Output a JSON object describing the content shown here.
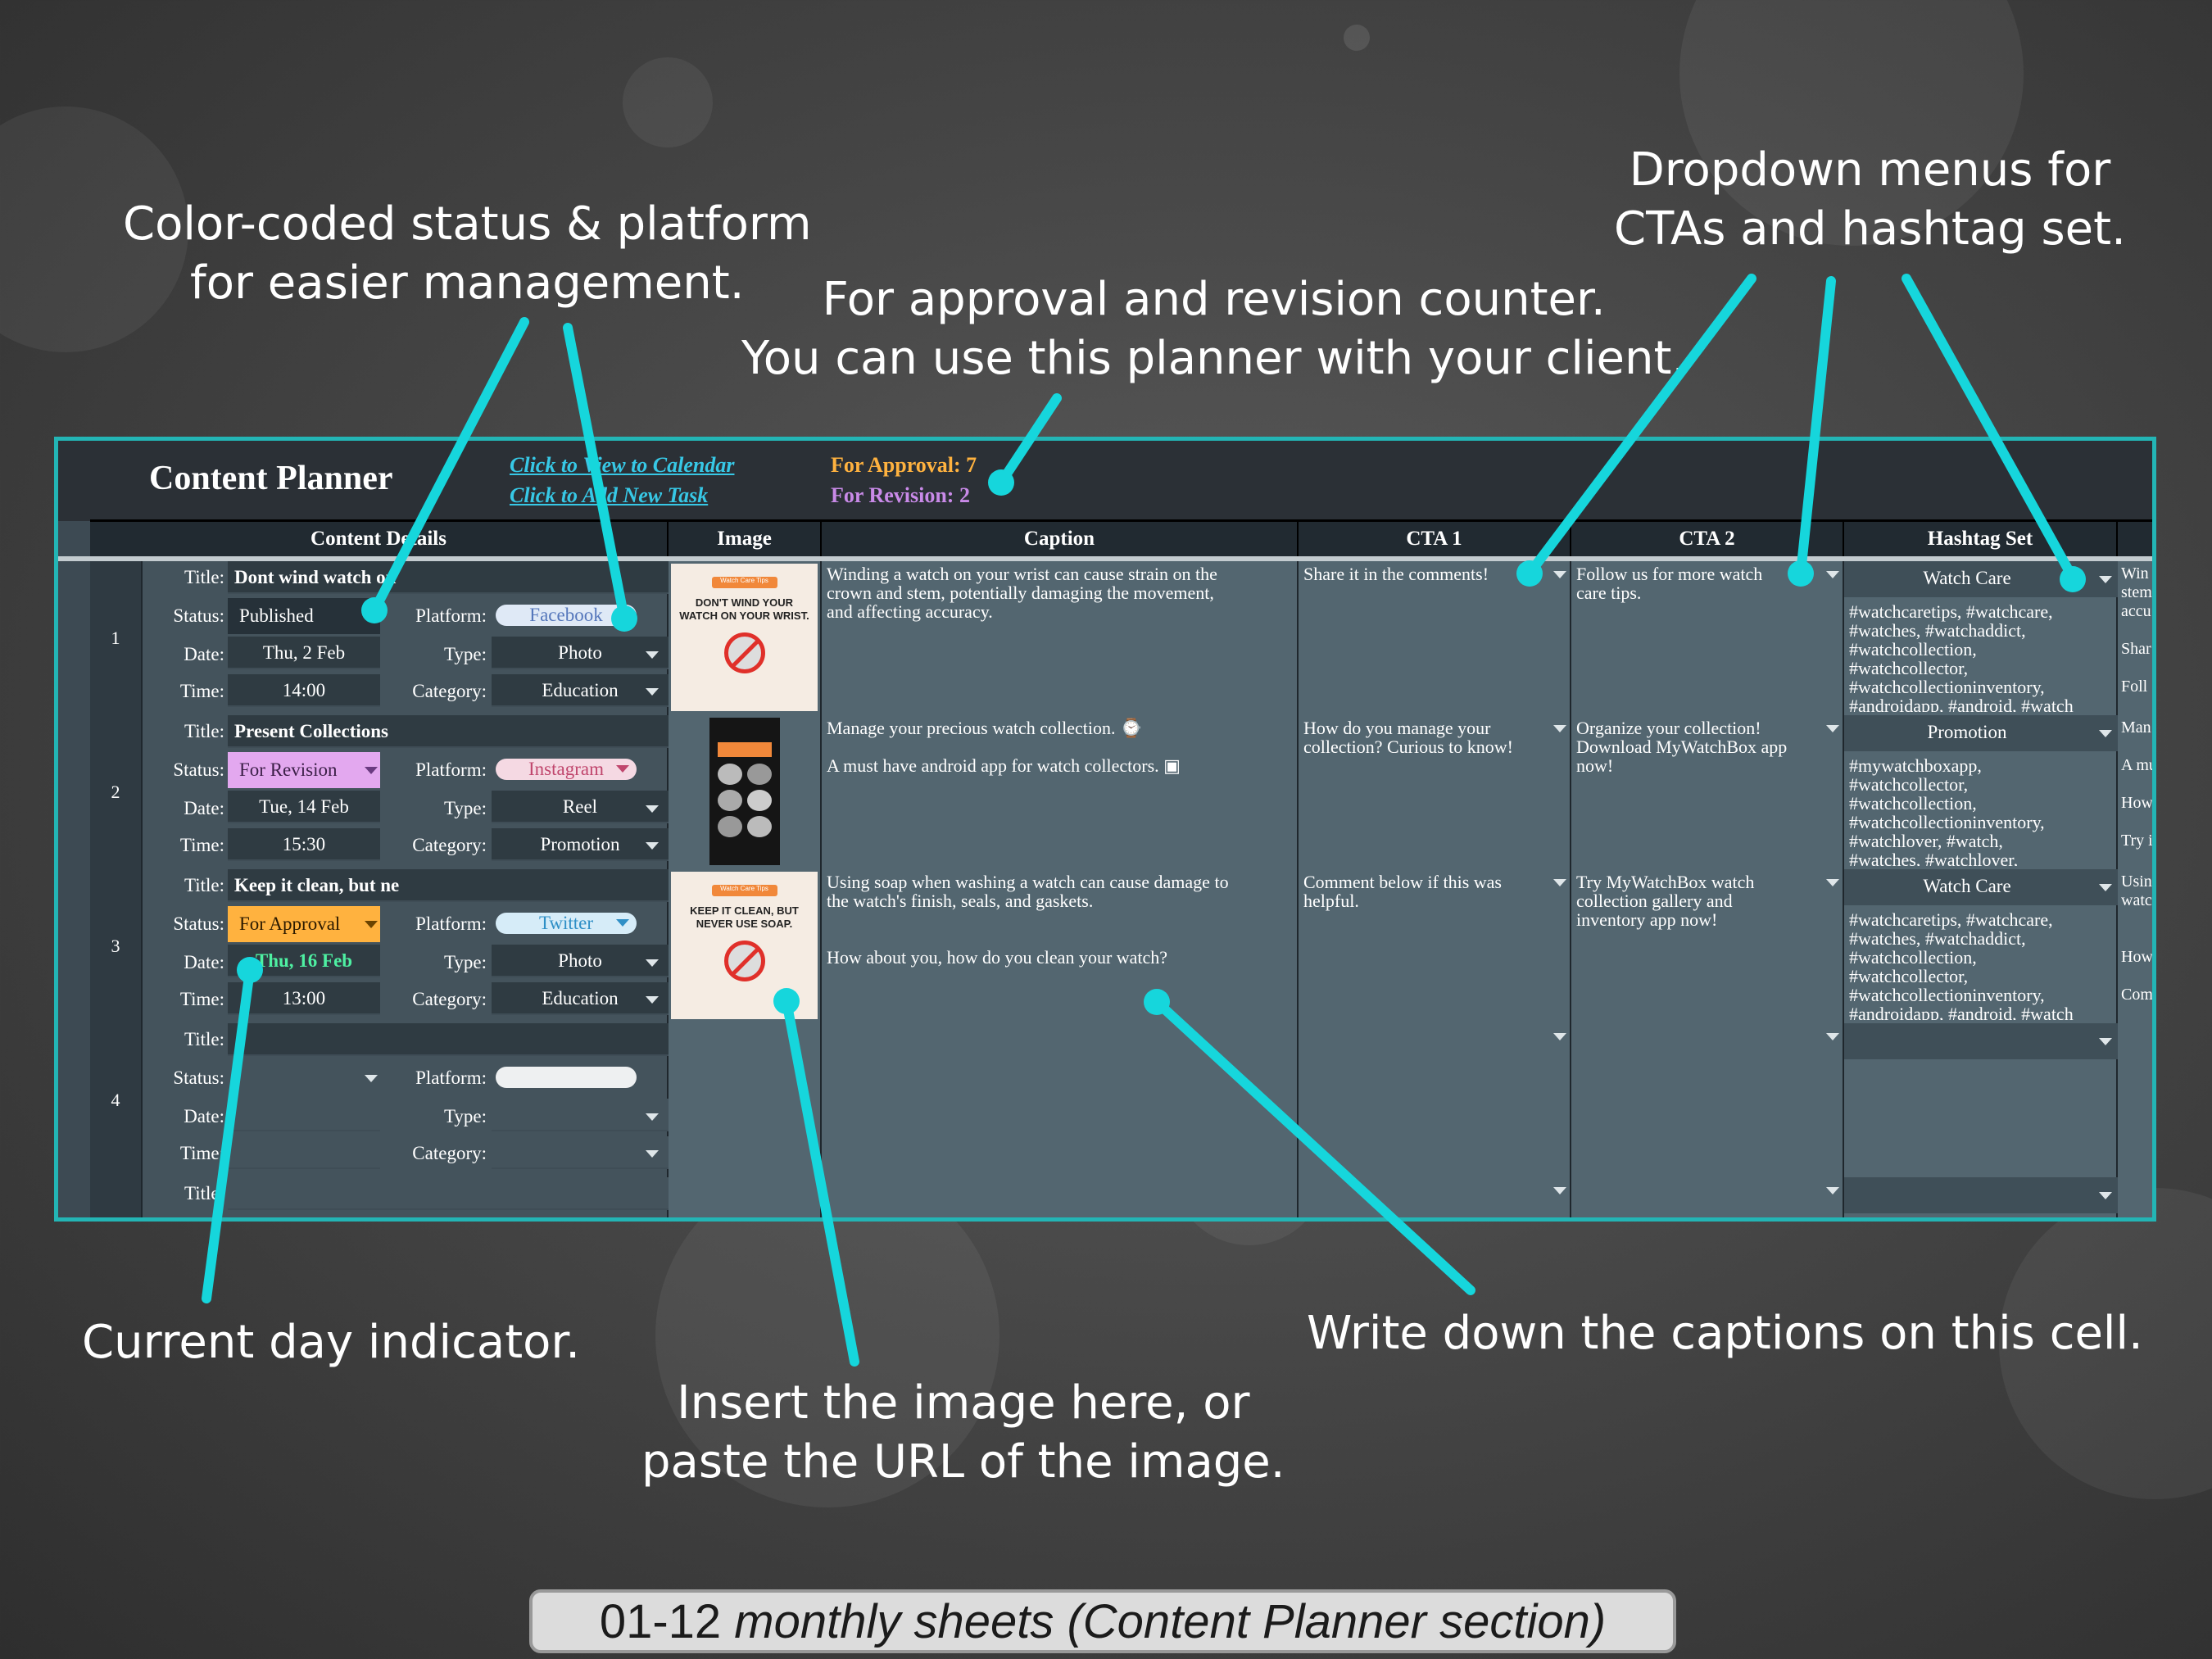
{
  "callouts": {
    "status_platform": [
      "Color-coded status & platform",
      "for easier management."
    ],
    "approval": [
      "For approval and revision counter.",
      "You can use this planner with your client."
    ],
    "dropdowns": [
      "Dropdown menus for",
      "CTAs and hashtag set."
    ],
    "current_day": "Current day indicator.",
    "insert_image": [
      "Insert the image here, or",
      "paste the URL of the image."
    ],
    "captions": "Write down the captions on this cell."
  },
  "planner": {
    "title": "Content Planner",
    "link_calendar": "Click to View to Calendar",
    "link_add_task": "Click to Add New Task",
    "for_approval": "For Approval: 7",
    "for_revision": "For Revision: 2",
    "columns": [
      "Content Details",
      "Image",
      "Caption",
      "CTA 1",
      "CTA 2",
      "Hashtag Set"
    ],
    "labels": {
      "title": "Title:",
      "status": "Status:",
      "date": "Date:",
      "time": "Time:",
      "platform": "Platform:",
      "type": "Type:",
      "category": "Category:"
    },
    "rows": [
      {
        "num": "1",
        "title": "Dont wind watch on",
        "status": "Published",
        "date": "Thu, 2 Feb",
        "time": "14:00",
        "platform": "Facebook",
        "type": "Photo",
        "category": "Education",
        "image_header": "Watch Care Tips",
        "image_text": "DON'T WIND YOUR WATCH ON YOUR WRIST.",
        "caption": "Winding a watch on your wrist can cause strain on the\ncrown and stem, potentially damaging the movement,\nand affecting accuracy.",
        "cta1": "Share it in the comments!",
        "cta2": "Follow us for more watch\ncare tips.",
        "hashtag_set": "Watch Care",
        "hashtags": "#watchcaretips, #watchcare,\n#watches, #watchaddict,\n#watchcollection,\n#watchcollector,\n#watchcollectioninventory,\n#androidapp, #android, #watch",
        "overflow": "Win\nstem\naccu\n\nShar\n\nFoll"
      },
      {
        "num": "2",
        "title": "Present Collections",
        "status": "For Revision",
        "date": "Tue, 14 Feb",
        "time": "15:30",
        "platform": "Instagram",
        "type": "Reel",
        "category": "Promotion",
        "caption": "Manage your precious watch collection. ⌚\n\nA must have android app for watch collectors. ▣",
        "cta1": "How do you manage your\ncollection? Curious to know!",
        "cta2": "Organize your collection!\nDownload MyWatchBox app\nnow!",
        "hashtag_set": "Promotion",
        "hashtags": "#mywatchboxapp,\n#watchcollector,\n#watchcollection,\n#watchcollectioninventory,\n#watchlover, #watch,\n#watches, #watchlover,",
        "overflow": "Man\n\nA mu\n\nHow\n\nTry i"
      },
      {
        "num": "3",
        "title": "Keep it clean, but ne",
        "status": "For Approval",
        "date": "Thu, 16 Feb",
        "time": "13:00",
        "platform": "Twitter",
        "type": "Photo",
        "category": "Education",
        "image_header": "Watch Care Tips",
        "image_text": "KEEP IT CLEAN, BUT NEVER USE SOAP.",
        "caption": "Using soap when washing a watch can cause damage to\nthe watch's finish, seals, and gaskets.\n\n\nHow about you, how do you clean your watch?",
        "cta1": "Comment below if this was\nhelpful.",
        "cta2": "Try MyWatchBox watch\ncollection gallery and\ninventory app now!",
        "hashtag_set": "Watch Care",
        "hashtags": "#watchcaretips, #watchcare,\n#watches, #watchaddict,\n#watchcollection,\n#watchcollector,\n#watchcollectioninventory,\n#androidapp, #android, #watch",
        "overflow": "Usin\nwatc\n\n\nHow\n\nCom"
      },
      {
        "num": "4",
        "title": "",
        "status": "",
        "date": "",
        "time": "",
        "platform": "",
        "type": "",
        "category": "",
        "caption": "",
        "cta1": "",
        "cta2": "",
        "hashtag_set": "",
        "hashtags": "",
        "overflow": ""
      }
    ],
    "row5_title_label": "Title:"
  },
  "footer": {
    "prefix": "01-12 ",
    "italic": "monthly sheets (Content Planner section)"
  },
  "colors": {
    "accent": "#23b5b5",
    "leader": "#16d6dc",
    "published": "#263139",
    "for_revision": "#e3a8ef",
    "for_approval": "#ffb23f",
    "facebook": "#dfe9f6",
    "instagram": "#f5d9e3",
    "twitter": "#d6ecf8",
    "current_day": "#4ef0a2"
  }
}
